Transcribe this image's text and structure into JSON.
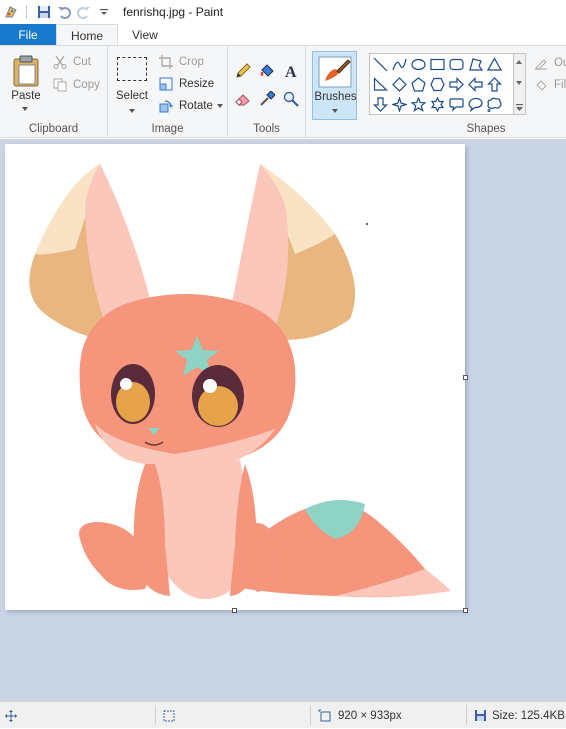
{
  "window": {
    "title": "fenrishq.jpg - Paint"
  },
  "tabs": {
    "file": "File",
    "home": "Home",
    "view": "View"
  },
  "clipboard": {
    "paste": "Paste",
    "cut": "Cut",
    "copy": "Copy",
    "label": "Clipboard"
  },
  "image": {
    "select": "Select",
    "crop": "Crop",
    "resize": "Resize",
    "rotate": "Rotate",
    "label": "Image"
  },
  "tools": {
    "label": "Tools"
  },
  "brushes": {
    "label": "Brushes"
  },
  "shapes": {
    "label": "Shapes",
    "outline": "Ou",
    "fill": "Fill"
  },
  "status": {
    "dimensions": "920 × 933px",
    "size": "Size: 125.4KB"
  },
  "colors": {
    "accent": "#1979ca",
    "workspace": "#c9d4e5",
    "ribbon": "#f5f6f7"
  }
}
